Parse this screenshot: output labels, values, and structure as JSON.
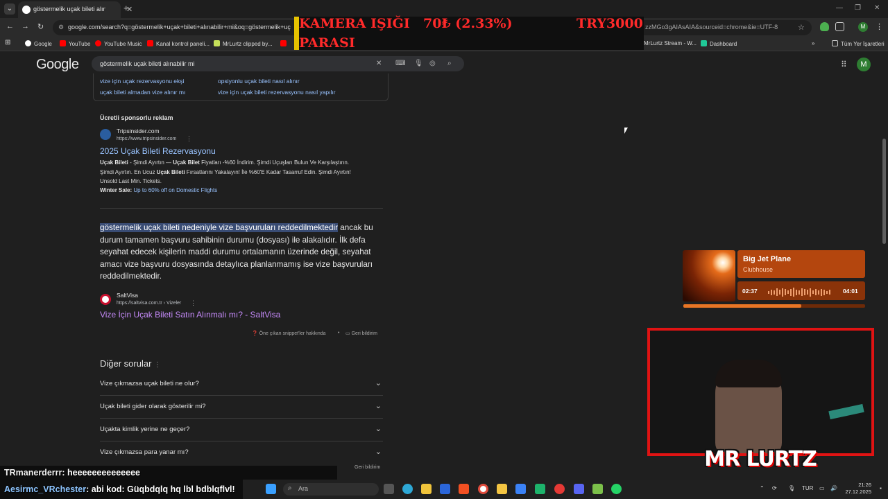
{
  "browser": {
    "tab_title": "göstermelik uçak bileti alınabilir",
    "url": "google.com/search?q=göstermelik+uçak+bileti+alınabilir+mi&oq=göstermelik+uç",
    "url_tail": "zzMGo3gAIAsAIA&sourceid=chrome&ie=UTF-8",
    "avatar_letter": "M",
    "bookmarks": [
      "Google",
      "YouTube",
      "YouTube Music",
      "Kanal kontrol paneli...",
      "MrLurtz clipped by...",
      "MrLurtz Stream - W...",
      "Dashboard"
    ],
    "all_bookmarks": "Tüm Yer İşaretleri"
  },
  "overlay": {
    "line1_a": "KAMERA IŞIĞI",
    "line1_b": "70₺ (2.33%)",
    "line1_c": "TRY3000",
    "line2": "PARASI"
  },
  "google": {
    "logo": "Google",
    "query": "göstermelik uçak bileti alınabilir mi",
    "related": [
      "vize için uçak rezervasyonu ekşi",
      "opsiyonlu uçak bileti nasıl alınır",
      "uçak bileti almadan vize alınır mı",
      "vize için uçak bileti rezervasyonu nasıl yapılır"
    ],
    "ad": {
      "label": "Ücretli sponsorlu reklam",
      "site": "Tripsinsider.com",
      "url": "https://www.tripsinsider.com",
      "title": "2025 Uçak Bileti Rezervasyonu",
      "s1_b1": "Uçak Bileti",
      "s1_t1": " - Şimdi Ayırtın — ",
      "s1_b2": "Uçak Bilet",
      "s1_t2": " Fiyatları -%60 İndirim. Şimdi Uçuşları Bulun Ve Karşılaştırın.",
      "s2_t1": "Şimdi Ayırtın. En Ucuz ",
      "s2_b1": "Uçak Bileti",
      "s2_t2": " Fırsatlarını Yakalayın! İle %60'E Kadar Tasarruf Edin. Şimdi Ayırtın!",
      "s3": "Unsold Last Min. Tickets.",
      "sale_label": "Winter Sale:",
      "sale_link": "Up to 60% off on Domestic Flights"
    },
    "featured": {
      "highlight": "göstermelik uçak bileti nedeniyle vize başvuruları reddedilmektedir",
      "rest": " ancak bu durum tamamen başvuru sahibinin durumu (dosyası) ile alakalıdır. İlk defa seyahat edecek kişilerin maddi durumu ortalamanın üzerinde değil, seyahat amacı vize başvuru dosyasında detaylıca planlanmamış ise vize başvuruları reddedilmektedir.",
      "site": "SaltVisa",
      "url": "https://saltvisa.com.tr › Vizeler",
      "title": "Vize İçin Uçak Bileti Satın Alınmalı mı? - SaltVisa",
      "about": "Öne çıkan snippet'ler hakkında",
      "feedback": "Geri bildirim"
    },
    "paa": {
      "title": "Diğer sorular",
      "questions": [
        "Vize çıkmazsa uçak bileti ne olur?",
        "Uçak bileti gider olarak gösterilir mi?",
        "Uçakta kimlik yerine ne geçer?",
        "Vize çıkmazsa para yanar mı?"
      ],
      "feedback": "Geri bildirim"
    }
  },
  "music": {
    "title": "Big Jet Plane",
    "artist": "Clubhouse",
    "elapsed": "02:37",
    "total": "04:01",
    "progress": 0.65
  },
  "stream": {
    "logo": "MR LURTZ",
    "chat": [
      {
        "user": "TRmanerderrr",
        "msg": ": heeeeeeeeeeeeee"
      },
      {
        "user": "Aesirmc_VRchester",
        "msg": ": abi kod: Güqbdqlq hq lbl bdblqflvl!"
      }
    ]
  },
  "taskbar": {
    "search": "Ara",
    "lang": "TUR",
    "time": "21:26",
    "date": "27.12.2025"
  }
}
